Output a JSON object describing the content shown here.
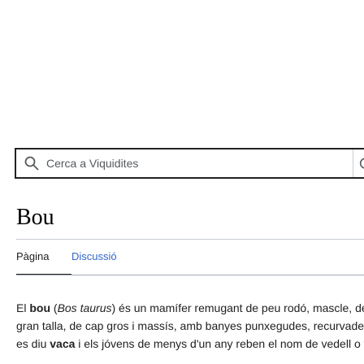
{
  "search": {
    "placeholder": "Cerca a Viquidites",
    "go_glyph": "C"
  },
  "article": {
    "title": "Bou"
  },
  "tabs": [
    {
      "label": "Pàgina",
      "active": true
    },
    {
      "label": "Discussió",
      "active": false
    }
  ],
  "lead": {
    "l1_pre": "El ",
    "l1_bold": "bou",
    "l1_open": " (",
    "l1_italic": "Bos taurus",
    "l1_post": ") és un mamífer remugant de peu rodó, mascle, de",
    "l2": "gran talla, de cap gros i massís, amb banyes punxegudes, recurvades",
    "l3_pre": "es diu ",
    "l3_bold": "vaca",
    "l3_post": " i els jóvens de menys d'un any reben el nom de vedell o v"
  },
  "colors": {
    "link": "#3366cc",
    "text": "#202122",
    "border": "#a2a9b1"
  },
  "icons": {
    "search": "search-icon"
  }
}
